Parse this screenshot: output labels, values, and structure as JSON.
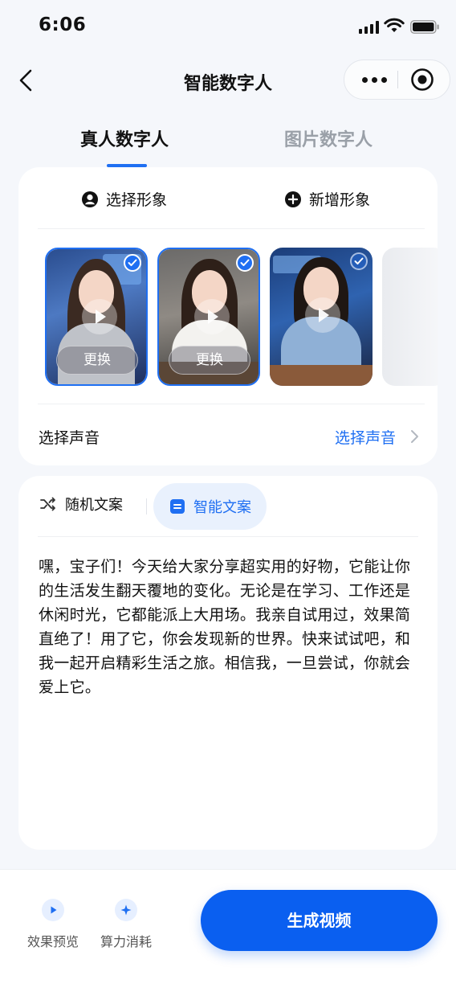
{
  "status_bar": {
    "time": "6:06"
  },
  "nav": {
    "title": "智能数字人"
  },
  "top_tabs": [
    {
      "label": "真人数字人",
      "active": true
    },
    {
      "label": "图片数字人",
      "active": false
    }
  ],
  "avatar_card": {
    "choose_label": "选择形象",
    "add_label": "新增形象",
    "avatars": [
      {
        "selected": true,
        "replace_label": "更换"
      },
      {
        "selected": true,
        "replace_label": "更换"
      },
      {
        "selected": false
      }
    ],
    "voice_label": "选择声音",
    "voice_link": "选择声音"
  },
  "copy_card": {
    "random_label": "随机文案",
    "smart_label": "智能文案",
    "text": "嘿，宝子们！今天给大家分享超实用的好物，它能让你的生活发生翻天覆地的变化。无论是在学习、工作还是休闲时光，它都能派上大用场。我亲自试用过，效果简直绝了！用了它，你会发现新的世界。快来试试吧，和我一起开启精彩生活之旅。相信我，一旦尝试，你就会爱上它。"
  },
  "bottom_bar": {
    "preview_label": "效果预览",
    "cost_label": "算力消耗",
    "generate_label": "生成视频"
  },
  "colors": {
    "accent": "#1f6ff2",
    "button": "#0a5ff0",
    "background": "#f5f7fb"
  }
}
